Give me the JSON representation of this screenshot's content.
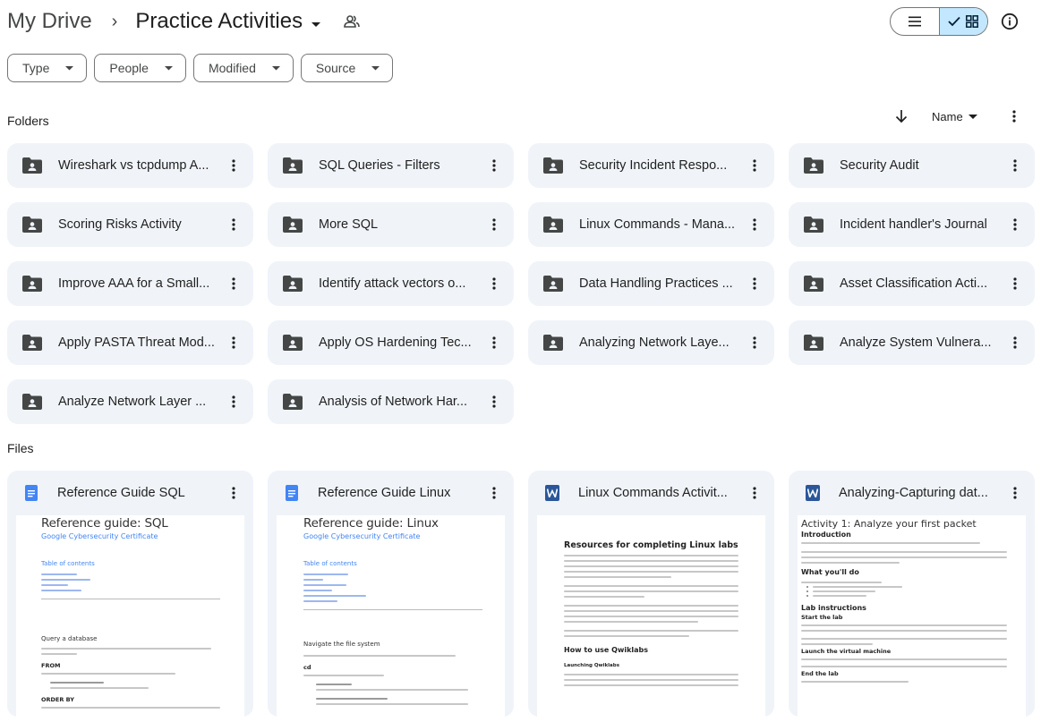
{
  "breadcrumb": {
    "root": "My Drive",
    "separator": "›",
    "current": "Practice Activities"
  },
  "filters": [
    "Type",
    "People",
    "Modified",
    "Source"
  ],
  "sections": {
    "folders_title": "Folders",
    "files_title": "Files"
  },
  "sort": {
    "label": "Name"
  },
  "folders": [
    "Wireshark vs tcpdump A...",
    "SQL Queries - Filters",
    "Security Incident Respo...",
    "Security Audit",
    "Scoring Risks Activity",
    "More SQL",
    "Linux Commands - Mana...",
    "Incident handler's Journal",
    "Improve AAA for a Small...",
    "Identify attack vectors o...",
    "Data Handling Practices ...",
    "Asset Classification Acti...",
    "Apply PASTA Threat Mod...",
    "Apply OS Hardening Tec...",
    "Analyzing Network Laye...",
    "Analyze System Vulnera...",
    "Analyze Network Layer ...",
    "Analysis of Network Har..."
  ],
  "files": [
    {
      "name": "Reference Guide SQL",
      "type": "google-docs",
      "icon_color": "#4285f4",
      "thumb": {
        "title": "Reference guide: SQL",
        "subtitle": "Google Cybersecurity Certificate",
        "toc": "Table of contents",
        "section": "Query a database",
        "keyword1": "FROM",
        "keyword2": "ORDER BY"
      }
    },
    {
      "name": "Reference Guide Linux",
      "type": "google-docs",
      "icon_color": "#4285f4",
      "thumb": {
        "title": "Reference guide: Linux",
        "subtitle": "Google Cybersecurity Certificate",
        "toc": "Table of contents",
        "section": "Navigate the file system",
        "keyword1": "cd"
      }
    },
    {
      "name": "Linux Commands Activit...",
      "type": "word",
      "icon_color": "#2b579a",
      "thumb": {
        "heading": "Resources for completing Linux labs",
        "heading2": "How to use Qwiklabs",
        "heading3": "Launching Qwiklabs"
      }
    },
    {
      "name": "Analyzing-Capturing dat...",
      "type": "word",
      "icon_color": "#2b579a",
      "thumb": {
        "title": "Activity 1: Analyze your first packet",
        "h_intro": "Introduction",
        "h_do": "What you'll do",
        "h_lab": "Lab instructions",
        "h_start": "Start the lab",
        "h_launch": "Launch the virtual machine",
        "h_end": "End the lab"
      }
    }
  ]
}
